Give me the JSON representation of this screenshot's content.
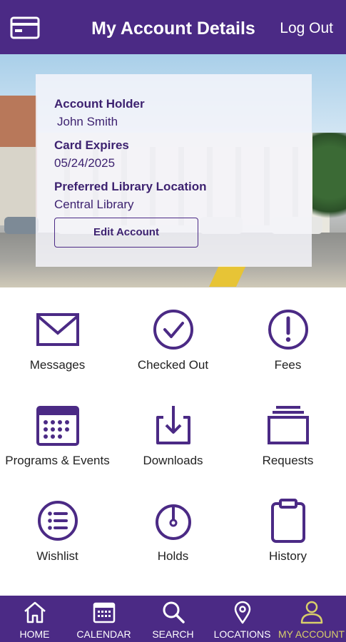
{
  "header": {
    "title": "My Account Details",
    "logout_label": "Log Out",
    "card_icon": "library-card-icon"
  },
  "account": {
    "holder_label": "Account Holder",
    "holder_value": "John Smith",
    "expires_label": "Card Expires",
    "expires_value": "05/24/2025",
    "location_label": "Preferred Library Location",
    "location_value": "Central Library",
    "edit_button": "Edit Account"
  },
  "tiles": [
    {
      "label": "Messages",
      "icon": "envelope-icon"
    },
    {
      "label": "Checked Out",
      "icon": "check-circle-icon"
    },
    {
      "label": "Fees",
      "icon": "exclamation-circle-icon"
    },
    {
      "label": "Programs & Events",
      "icon": "calendar-icon"
    },
    {
      "label": "Downloads",
      "icon": "download-icon"
    },
    {
      "label": "Requests",
      "icon": "stack-icon"
    },
    {
      "label": "Wishlist",
      "icon": "list-circle-icon"
    },
    {
      "label": "Holds",
      "icon": "timer-icon"
    },
    {
      "label": "History",
      "icon": "clipboard-icon"
    }
  ],
  "nav": [
    {
      "label": "HOME",
      "icon": "home-icon",
      "active": false
    },
    {
      "label": "CALENDAR",
      "icon": "calendar-icon",
      "active": false
    },
    {
      "label": "SEARCH",
      "icon": "search-icon",
      "active": false
    },
    {
      "label": "LOCATIONS",
      "icon": "location-pin-icon",
      "active": false
    },
    {
      "label": "MY ACCOUNT",
      "icon": "user-icon",
      "active": true
    }
  ],
  "colors": {
    "brand": "#4b2a85",
    "active_nav": "#d9cf6a",
    "icon_stroke": "#4b2a85"
  }
}
